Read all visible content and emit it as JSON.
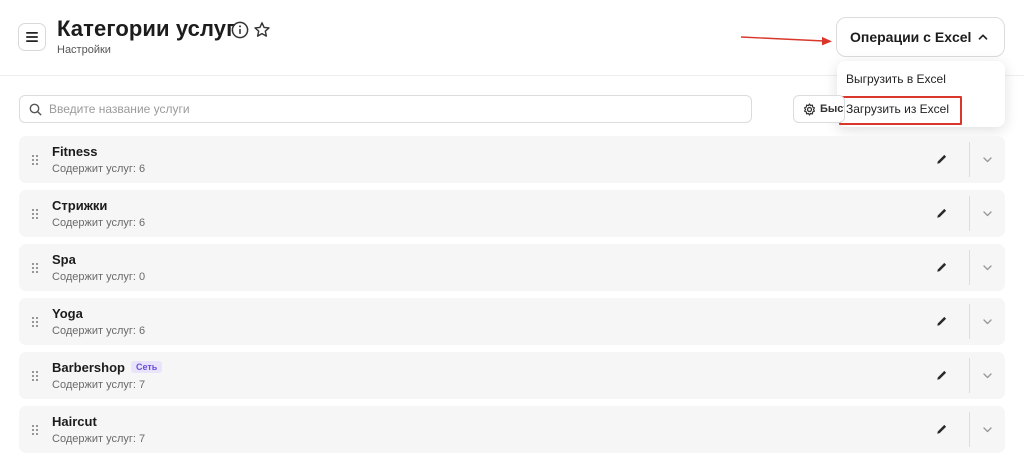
{
  "header": {
    "title": "Категории услуг",
    "subtitle": "Настройки"
  },
  "excel": {
    "button_label": "Операции с Excel",
    "menu": [
      {
        "label": "Выгрузить в Excel"
      },
      {
        "label": "Загрузить из Excel"
      }
    ]
  },
  "search": {
    "placeholder": "Введите название услуги"
  },
  "toolbar": {
    "partial_button_label": "Быстрые"
  },
  "categories": [
    {
      "name": "Fitness",
      "count": "Содержит услуг: 6",
      "badge": ""
    },
    {
      "name": "Стрижки",
      "count": "Содержит услуг: 6",
      "badge": ""
    },
    {
      "name": "Spa",
      "count": "Содержит услуг: 0",
      "badge": ""
    },
    {
      "name": "Yoga",
      "count": "Содержит услуг: 6",
      "badge": ""
    },
    {
      "name": "Barbershop",
      "count": "Содержит услуг: 7",
      "badge": "Сеть"
    },
    {
      "name": "Haircut",
      "count": "Содержит услуг: 7",
      "badge": ""
    }
  ],
  "colors": {
    "highlight": "#d9372c",
    "badge_text": "#6b4fd8",
    "badge_bg": "#e9e4fb",
    "row_bg": "#f6f6f6"
  },
  "icons": {
    "menu": "hamburger-icon",
    "info": "info-icon",
    "favorite": "star-icon",
    "search": "search-icon",
    "settings": "gear-icon",
    "drag": "drag-handle-icon",
    "edit": "pencil-icon",
    "expand": "chevron-down-icon",
    "collapse": "chevron-up-icon"
  }
}
